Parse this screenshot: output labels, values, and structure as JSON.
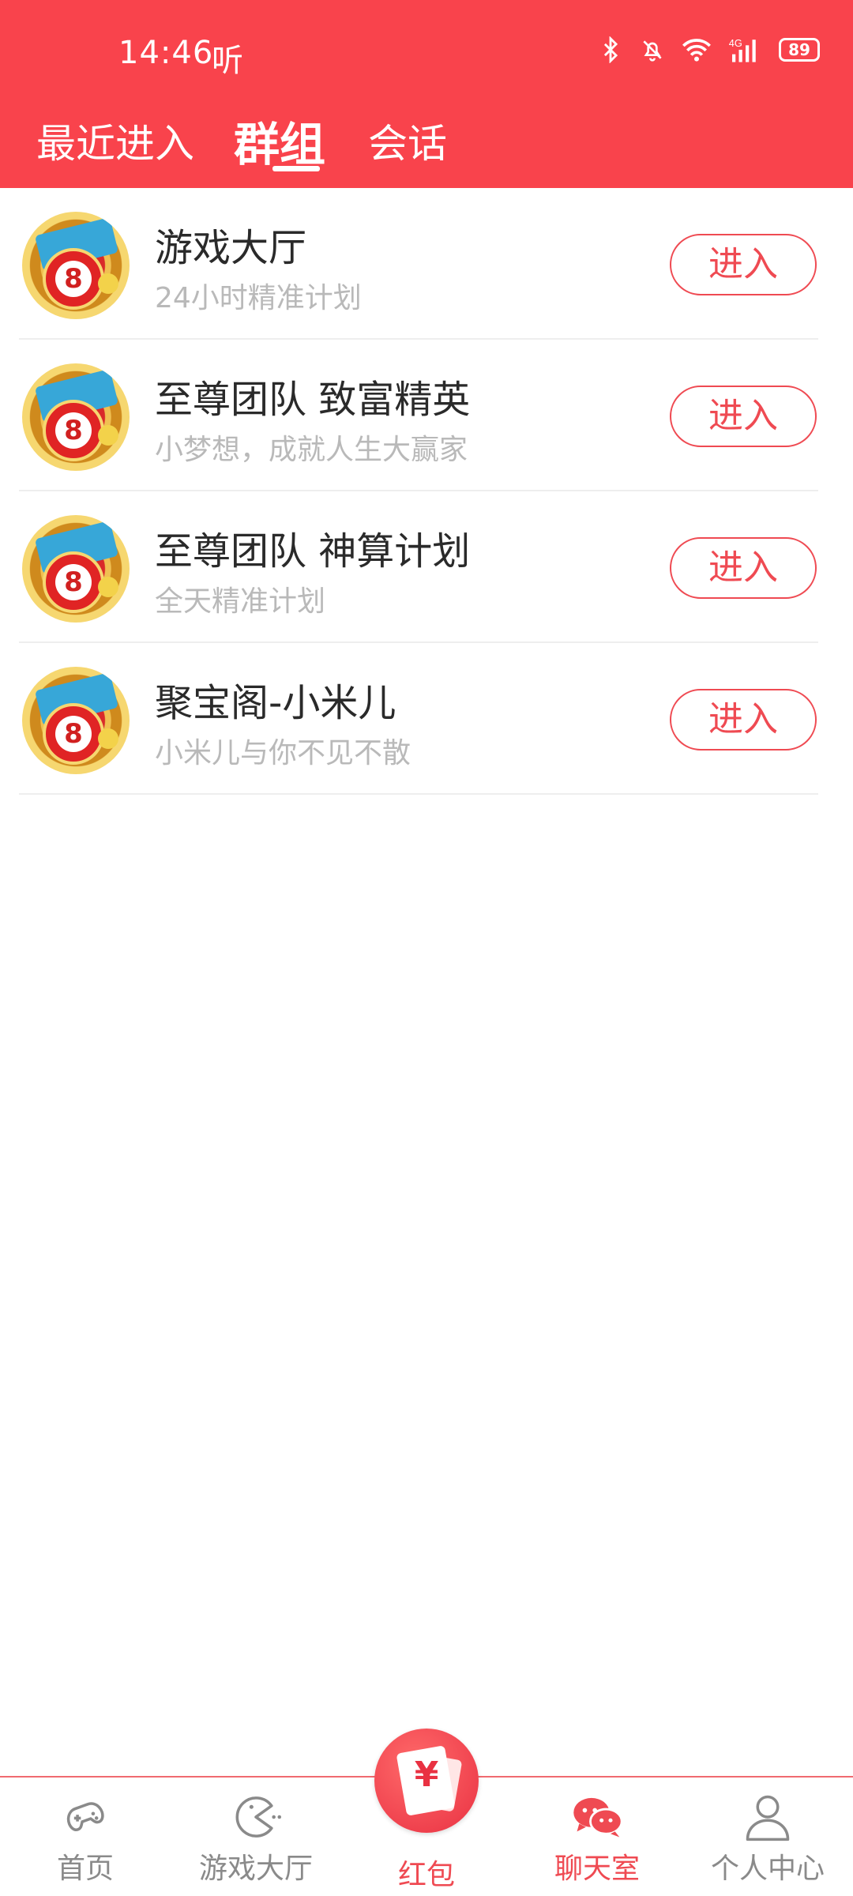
{
  "status_bar": {
    "time": "14:46",
    "extra": "听",
    "battery": "89",
    "icons": [
      "bluetooth-icon",
      "mute-bell-icon",
      "wifi-icon",
      "4g-signal-icon",
      "battery-icon"
    ]
  },
  "tabs": [
    {
      "label": "最近进入",
      "active": false
    },
    {
      "label": "群组",
      "active": true
    },
    {
      "label": "会话",
      "active": false
    }
  ],
  "groups": [
    {
      "title": "游戏大厅",
      "subtitle": "24小时精准计划",
      "button": "进入",
      "avatar_number": "8"
    },
    {
      "title": "至尊团队 致富精英",
      "subtitle": "小梦想，成就人生大赢家",
      "button": "进入",
      "avatar_number": "8"
    },
    {
      "title": "至尊团队 神算计划",
      "subtitle": "全天精准计划",
      "button": "进入",
      "avatar_number": "8"
    },
    {
      "title": "聚宝阁-小米儿",
      "subtitle": " 小米儿与你不见不散",
      "button": "进入",
      "avatar_number": "8"
    }
  ],
  "bottom_nav": [
    {
      "label": "首页",
      "icon": "gamepad-icon",
      "active": false
    },
    {
      "label": "游戏大厅",
      "icon": "pacman-icon",
      "active": false
    },
    {
      "label": "红包",
      "icon": "red-envelope-icon",
      "active": false
    },
    {
      "label": "聊天室",
      "icon": "chat-bubbles-icon",
      "active": true
    },
    {
      "label": "个人中心",
      "icon": "person-icon",
      "active": false
    }
  ],
  "redpacket_symbol": "¥",
  "colors": {
    "primary": "#f9434c",
    "accent": "#ef4a52",
    "subtitle": "#b9b9b9",
    "nav_inactive": "#8a8a8a"
  }
}
